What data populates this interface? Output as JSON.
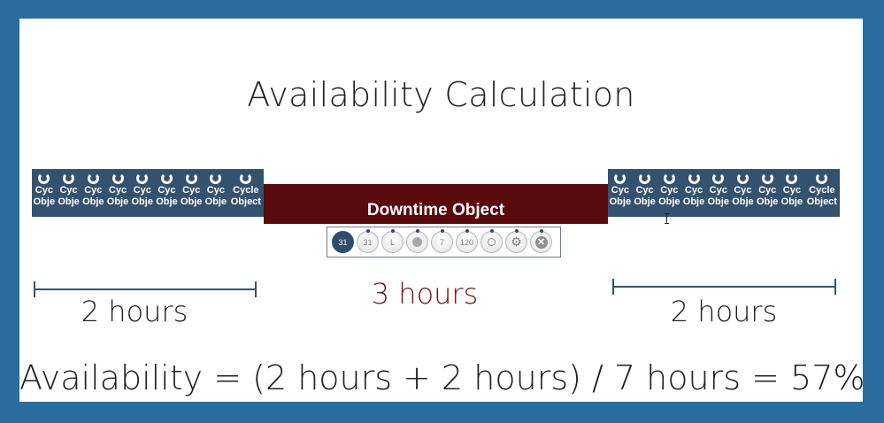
{
  "title": "Availability Calculation",
  "cycle_objects_left": [
    {
      "l1": "Cyc",
      "l2": "Obje"
    },
    {
      "l1": "Cyc",
      "l2": "Obje"
    },
    {
      "l1": "Cyc",
      "l2": "Obje"
    },
    {
      "l1": "Cyc",
      "l2": "Obje"
    },
    {
      "l1": "Cyc",
      "l2": "Obje"
    },
    {
      "l1": "Cyc",
      "l2": "Obje"
    },
    {
      "l1": "Cyc",
      "l2": "Obje"
    },
    {
      "l1": "Cyc",
      "l2": "Obje"
    },
    {
      "l1": "Cycle",
      "l2": "Object"
    }
  ],
  "cycle_objects_right": [
    {
      "l1": "Cyc",
      "l2": "Obje"
    },
    {
      "l1": "Cyc",
      "l2": "Obje"
    },
    {
      "l1": "Cyc",
      "l2": "Obje"
    },
    {
      "l1": "Cyc",
      "l2": "Obje"
    },
    {
      "l1": "Cyc",
      "l2": "Obje"
    },
    {
      "l1": "Cyc",
      "l2": "Obje"
    },
    {
      "l1": "Cyc",
      "l2": "Obje"
    },
    {
      "l1": "Cyc",
      "l2": "Obje"
    },
    {
      "l1": "Cycle",
      "l2": "Object"
    }
  ],
  "downtime": {
    "label": "Downtime Object"
  },
  "toolbar": {
    "calendar_day": "31",
    "calendar_month": "31",
    "step": "L",
    "interval_7": "7",
    "interval_120": "120",
    "delete": "✕",
    "settings": "⚙"
  },
  "spans": {
    "left_label": "2 hours",
    "middle_label": "3 hours",
    "right_label": "2 hours"
  },
  "formula": "Availability = (2 hours + 2 hours) / 7 hours = 57%",
  "colors": {
    "frame": "#2a6d9e",
    "cycle_bg": "#34526f",
    "downtime_bg": "#580a0c",
    "middle_label": "#6e1416"
  }
}
